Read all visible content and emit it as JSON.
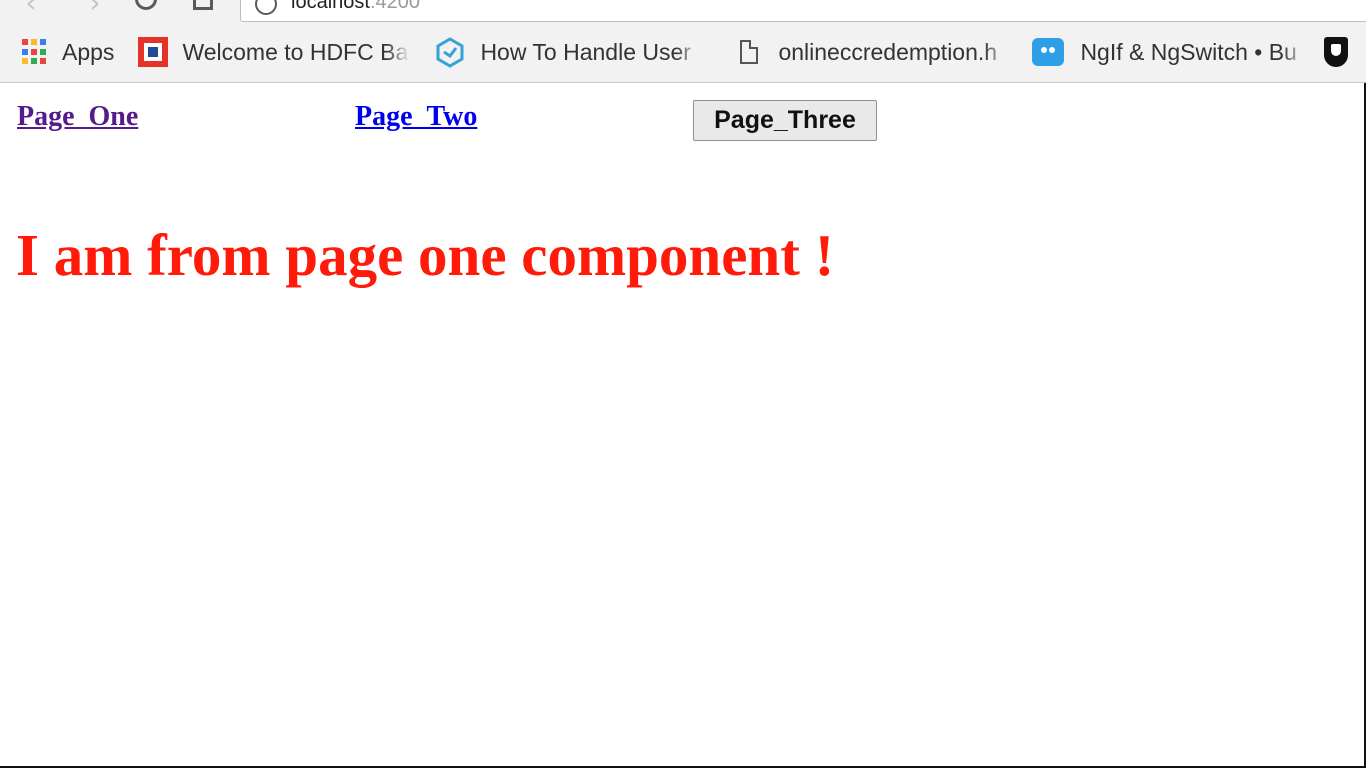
{
  "browser": {
    "url_host": "localhost",
    "url_port": ":4200",
    "bookmarks": [
      {
        "label": "Apps",
        "icon": "apps-grid-icon"
      },
      {
        "label": "Welcome to HDFC Ba",
        "icon": "hdfc-icon"
      },
      {
        "label": "How To Handle User",
        "icon": "toolsqa-icon"
      },
      {
        "label": "onlineccredemption.h",
        "icon": "file-icon"
      },
      {
        "label": "NgIf & NgSwitch • Bu",
        "icon": "robot-icon"
      }
    ]
  },
  "page": {
    "links": [
      {
        "label": "Page_One",
        "state": "visited"
      },
      {
        "label": "Page_Two",
        "state": "unvisited"
      }
    ],
    "button_label": "Page_Three",
    "heading": "I am from page one component !",
    "colors": {
      "heading": "#ff1a0a",
      "visited_link": "#551a8b",
      "unvisited_link": "#0000ee"
    }
  }
}
